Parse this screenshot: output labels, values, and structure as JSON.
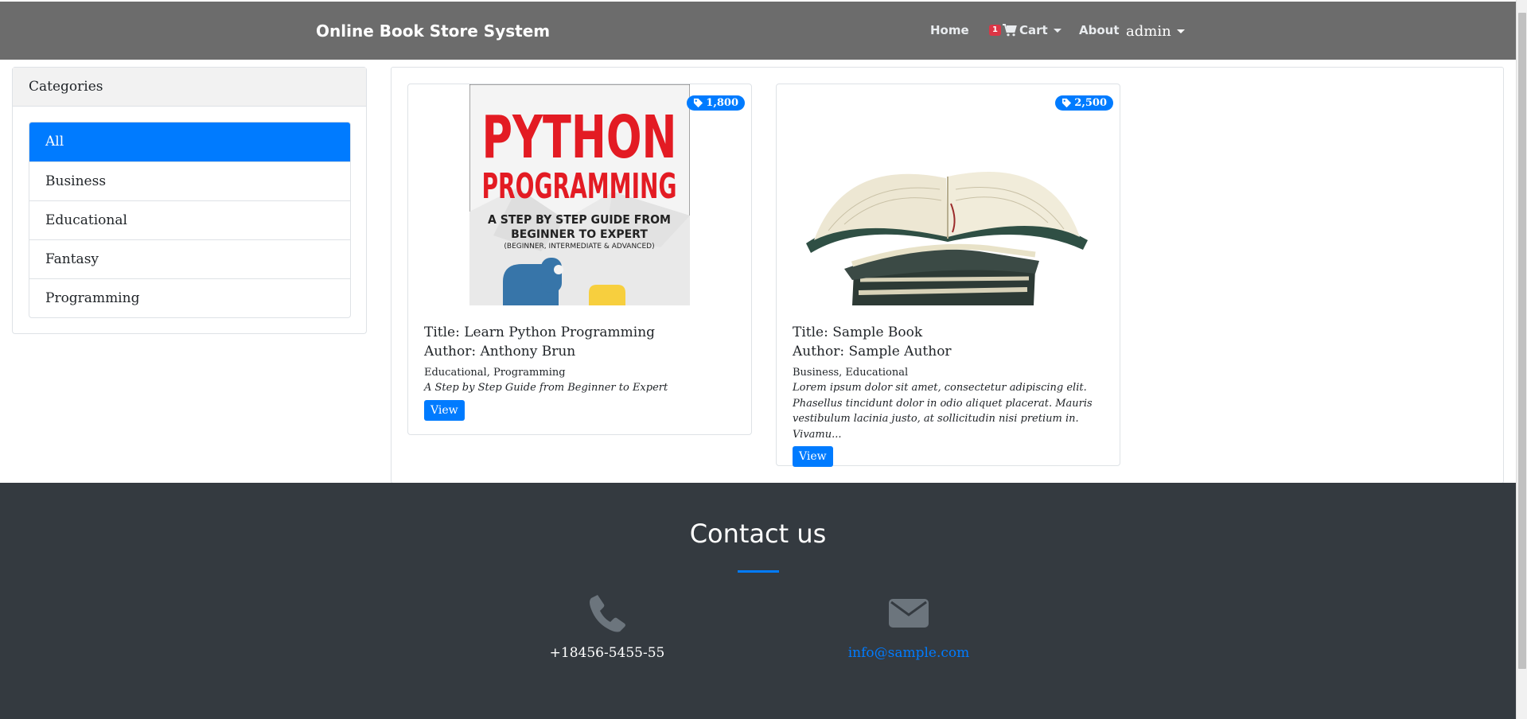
{
  "navbar": {
    "brand": "Online Book Store System",
    "home": "Home",
    "cart_count": "1",
    "cart": "Cart",
    "about": "About",
    "user": "admin"
  },
  "sidebar": {
    "header": "Categories",
    "items": [
      {
        "label": "All",
        "active": true
      },
      {
        "label": "Business"
      },
      {
        "label": "Educational"
      },
      {
        "label": "Fantasy"
      },
      {
        "label": "Programming"
      }
    ]
  },
  "books": [
    {
      "price": "1,800",
      "title": "Title: Learn Python Programming",
      "author": "Author: Anthony Brun",
      "categories": "Educational, Programming",
      "description": "A Step by Step Guide from Beginner to Expert",
      "button": "View",
      "cover": {
        "line1": "PYTHON",
        "line2": "PROGRAMMING",
        "sub1": "A STEP BY STEP GUIDE FROM",
        "sub2": "BEGINNER TO EXPERT",
        "sub3": "(BEGINNER, INTERMEDIATE & ADVANCED)"
      }
    },
    {
      "price": "2,500",
      "title": "Title: Sample Book",
      "author": "Author: Sample Author",
      "categories": "Business, Educational",
      "description": "Lorem ipsum dolor sit amet, consectetur adipiscing elit. Phasellus tincidunt dolor in odio aliquet placerat. Mauris vestibulum lacinia justo, at sollicitudin nisi pretium in. Vivamu...",
      "button": "View"
    }
  ],
  "footer": {
    "title": "Contact us",
    "phone": "+18456-5455-55",
    "email": "info@sample.com"
  },
  "colors": {
    "navbar": "#6c6c6c",
    "accent": "#007bff",
    "footer": "#343a40",
    "badge": "#dc3545",
    "cover_red": "#e31b23"
  },
  "icons": [
    "cart-icon",
    "tag-icon",
    "phone-icon",
    "envelope-icon",
    "caret-down-icon"
  ]
}
